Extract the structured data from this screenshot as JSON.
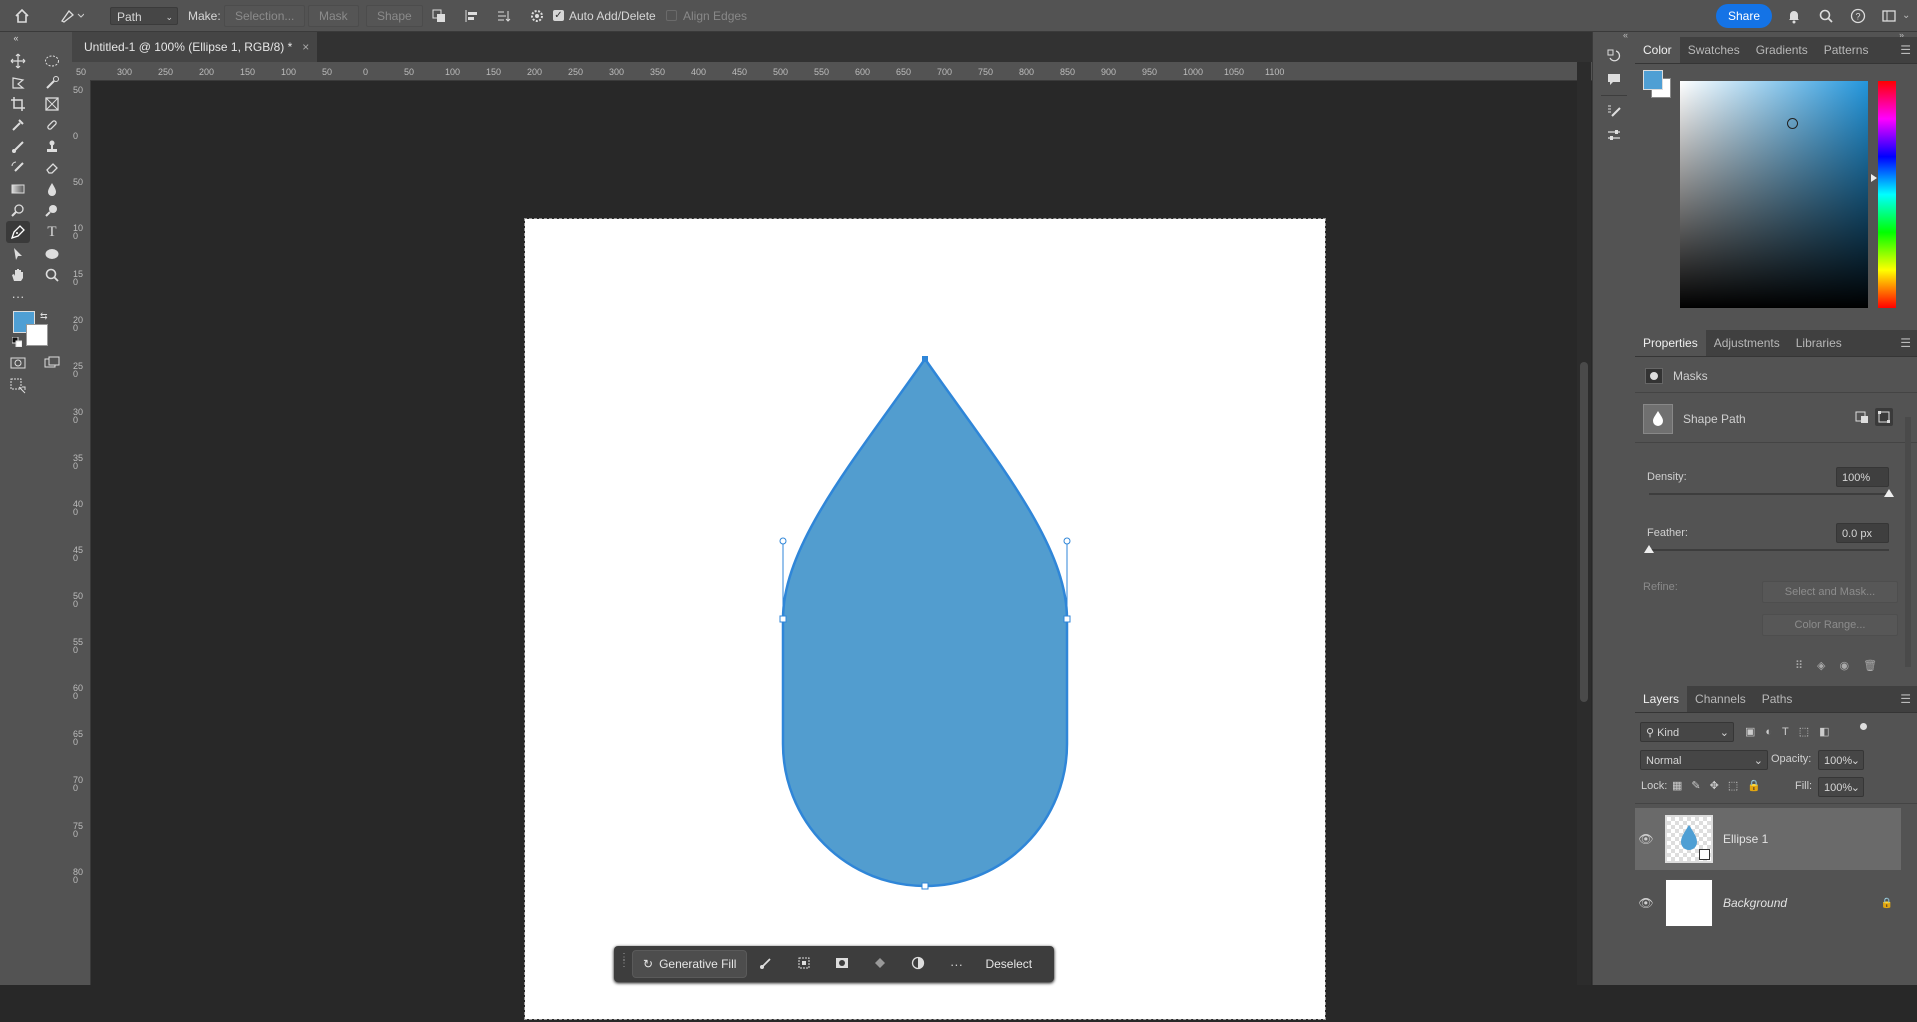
{
  "options_bar": {
    "mode_value": "Path",
    "make_label": "Make:",
    "selection_btn": "Selection...",
    "mask_btn": "Mask",
    "shape_btn": "Shape",
    "auto_add_delete": "Auto Add/Delete",
    "align_edges": "Align Edges",
    "share": "Share"
  },
  "document_tab": {
    "title": "Untitled-1 @ 100% (Ellipse 1, RGB/8) *",
    "close": "×"
  },
  "ruler_h": [
    "50",
    "300",
    "250",
    "200",
    "150",
    "100",
    "50",
    "0",
    "50",
    "100",
    "150",
    "200",
    "250",
    "300",
    "350",
    "400",
    "450",
    "500",
    "550",
    "600",
    "650",
    "700",
    "750",
    "800",
    "850",
    "900",
    "950",
    "1000",
    "1050",
    "1100"
  ],
  "ruler_v": [
    "50",
    "0",
    "50",
    "100",
    "150",
    "200",
    "250",
    "300",
    "350",
    "400",
    "450",
    "500",
    "550",
    "600",
    "650",
    "700",
    "750",
    "800"
  ],
  "context_bar": {
    "generative_fill": "Generative Fill",
    "deselect": "Deselect",
    "more": "···"
  },
  "colors": {
    "foreground": "#4f9fd4",
    "background": "#ffffff",
    "shape_fill": "#529dcf",
    "shape_stroke": "#2f86d8",
    "accent": "#1473e6"
  },
  "color_panel": {
    "tabs": [
      "Color",
      "Swatches",
      "Gradients",
      "Patterns"
    ],
    "active": "Color"
  },
  "properties_panel": {
    "tabs": [
      "Properties",
      "Adjustments",
      "Libraries"
    ],
    "section": "Masks",
    "shape_path": "Shape Path",
    "density_label": "Density:",
    "density_value": "100%",
    "density": 1.0,
    "feather_label": "Feather:",
    "feather_value": "0.0 px",
    "refine_label": "Refine:",
    "select_and_mask": "Select and Mask...",
    "color_range": "Color Range..."
  },
  "layers_panel": {
    "tabs": [
      "Layers",
      "Channels",
      "Paths"
    ],
    "filter_kind": "Kind",
    "blend_mode": "Normal",
    "opacity_label": "Opacity:",
    "opacity_value": "100%",
    "lock_label": "Lock:",
    "fill_label": "Fill:",
    "fill_value": "100%",
    "layers": [
      {
        "name": "Ellipse 1",
        "selected": true
      },
      {
        "name": "Background",
        "locked": true
      }
    ]
  }
}
